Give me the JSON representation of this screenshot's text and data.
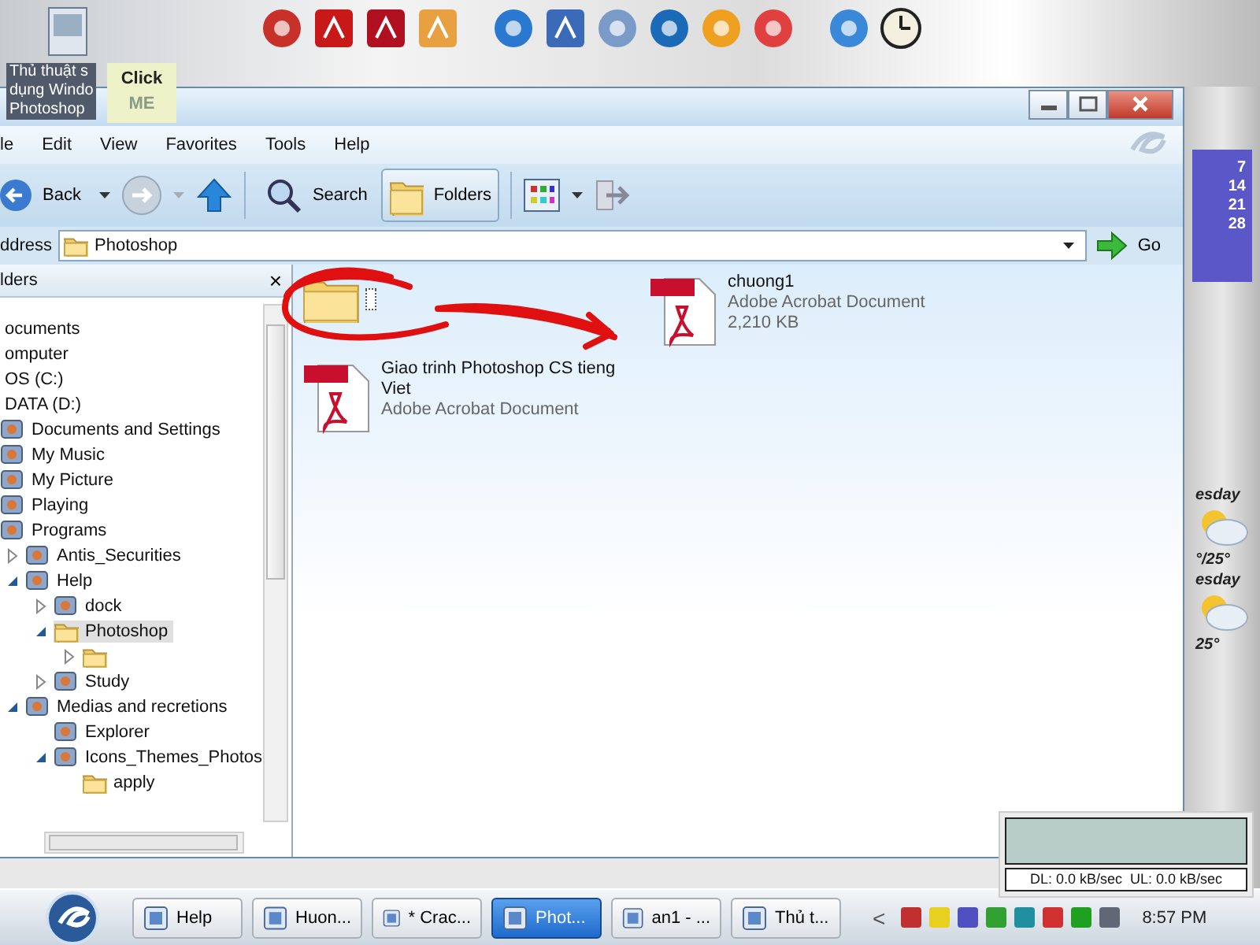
{
  "desktop": {
    "shortcut": {
      "label_lines": [
        "Thủ thuật s",
        "dụng Windo",
        "Photoshop"
      ]
    },
    "sticky_note": {
      "lines": [
        "Click",
        "ME"
      ]
    }
  },
  "window": {
    "menu": [
      "le",
      "Edit",
      "View",
      "Favorites",
      "Tools",
      "Help"
    ],
    "toolbar": {
      "back": "Back",
      "search": "Search",
      "folders": {
        "label": "Folders",
        "selected": true
      }
    },
    "address": {
      "label": "ddress",
      "value": "Photoshop",
      "go": "Go"
    },
    "folders_pane": {
      "title": "lders",
      "close": "×",
      "tree": [
        {
          "label": "ocuments",
          "selected": false
        },
        {
          "label": "omputer",
          "selected": false
        },
        {
          "label": "OS (C:)",
          "selected": false
        },
        {
          "label": "DATA (D:)",
          "selected": false,
          "children": [
            {
              "label": "Documents and Settings",
              "kind": "app",
              "selected": false
            },
            {
              "label": "My Music",
              "kind": "app",
              "selected": false
            },
            {
              "label": "My Picture",
              "kind": "app",
              "selected": false
            },
            {
              "label": "Playing",
              "kind": "app",
              "selected": false
            },
            {
              "label": "Programs",
              "kind": "app",
              "selected": false,
              "children": [
                {
                  "label": "Antis_Securities",
                  "kind": "app",
                  "expanded": false,
                  "selected": false
                },
                {
                  "label": "Help",
                  "kind": "app",
                  "expanded": true,
                  "selected": false,
                  "children": [
                    {
                      "label": "dock",
                      "kind": "app",
                      "expanded": false,
                      "selected": false
                    },
                    {
                      "label": "Photoshop",
                      "kind": "folder",
                      "expanded": true,
                      "selected": true,
                      "children": [
                        {
                          "kind": "folder",
                          "expanded": false,
                          "selected": false
                        }
                      ]
                    },
                    {
                      "label": "Study",
                      "kind": "app",
                      "expanded": false,
                      "selected": false
                    }
                  ]
                },
                {
                  "label": "Medias and recretions",
                  "kind": "app",
                  "expanded": true,
                  "selected": false,
                  "children": [
                    {
                      "label": "Explorer",
                      "kind": "app",
                      "selected": false
                    },
                    {
                      "label": "Icons_Themes_Photos",
                      "kind": "app",
                      "expanded": true,
                      "selected": false,
                      "children": [
                        {
                          "label": "apply",
                          "kind": "folder",
                          "selected": false
                        }
                      ]
                    }
                  ]
                }
              ]
            }
          ]
        }
      ]
    },
    "files": [
      {
        "kind": "folder",
        "renaming": true
      },
      {
        "kind": "pdf",
        "name": "chuong1",
        "type": "Adobe Acrobat Document",
        "size": "2,210 KB"
      },
      {
        "kind": "pdf",
        "name": "Giao trinh Photoshop CS tieng Viet",
        "type": "Adobe Acrobat Document"
      }
    ]
  },
  "gadgets": {
    "calendar_days": [
      "7",
      "14",
      "21",
      "28"
    ],
    "weather": [
      "esday",
      "°/25°",
      "esday",
      "25°"
    ],
    "network_meter": {
      "reading": "DL: 0.0 kB/sec  UL: 0.0 kB/sec"
    }
  },
  "taskbar": {
    "buttons": [
      {
        "label": "Help",
        "selected": false
      },
      {
        "label": "Huon...",
        "selected": false
      },
      {
        "label": "* Crac...",
        "selected": false
      },
      {
        "label": "Phot...",
        "selected": true
      },
      {
        "label": "an1 - ...",
        "selected": false
      },
      {
        "label": "Thủ t...",
        "selected": false
      }
    ],
    "tray_toggle": "<",
    "clock": "8:57 PM"
  }
}
